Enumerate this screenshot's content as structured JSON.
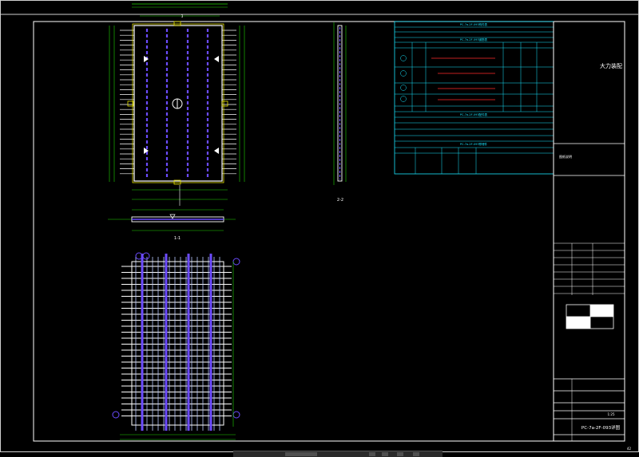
{
  "title_block": {
    "project_label": "大力装配",
    "drawing_name": "PC-7a-2F-093详图",
    "section_label_1": "1-1",
    "section_label_2": "2-2",
    "scale": "1:25",
    "sheet": "42",
    "note": "图纸说明"
  },
  "tables": {
    "table1_title": "PC-7a-2F-093构件表",
    "table2_title": "PC-7a-2F-093钢筋表",
    "table3_title": "PC-7a-2F-093配件表",
    "table4_title": "PC-7a-2F-093预埋件"
  },
  "status_bar": {
    "label": "模型"
  }
}
